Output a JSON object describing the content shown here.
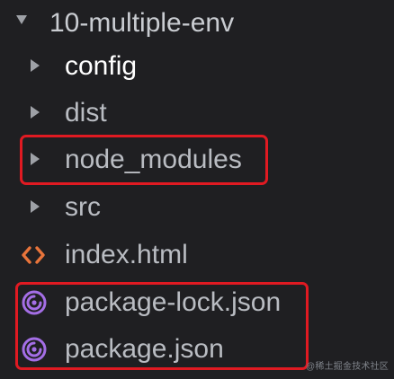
{
  "root": {
    "label": "10-multiple-env",
    "icon": "chevron-down-icon"
  },
  "items": [
    {
      "label": "config",
      "type": "folder",
      "icon": "chevron-right-icon"
    },
    {
      "label": "dist",
      "type": "folder",
      "icon": "chevron-right-icon"
    },
    {
      "label": "node_modules",
      "type": "folder",
      "icon": "chevron-right-icon",
      "highlighted": true
    },
    {
      "label": "src",
      "type": "folder",
      "icon": "chevron-right-icon"
    },
    {
      "label": "index.html",
      "type": "file",
      "icon": "html-file-icon"
    },
    {
      "label": "package-lock.json",
      "type": "file",
      "icon": "package-json-icon",
      "highlighted": true
    },
    {
      "label": "package.json",
      "type": "file",
      "icon": "package-json-icon",
      "highlighted": true
    }
  ],
  "watermark": "@稀土掘金技术社区",
  "colors": {
    "background": "#1f1f22",
    "text": "#b9bcc2",
    "text_bright": "#ffffff",
    "highlight": "#e01a22",
    "html_icon": "#e8743b",
    "package_icon": "#a46ee6"
  }
}
